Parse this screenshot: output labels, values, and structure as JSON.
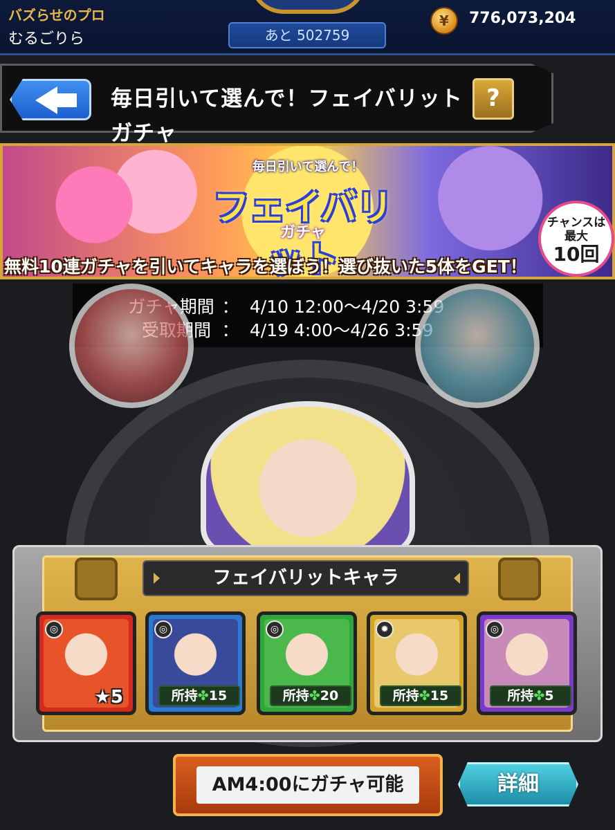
{
  "status": {
    "rank_title": "バズらせのプロ",
    "player_name": "むるごりら",
    "stamina_text": "あと 502759",
    "coin_amount": "776,073,204"
  },
  "header": {
    "title": "毎日引いて選んで！フェイバリットガチャ",
    "help_label": "?"
  },
  "banner": {
    "subtitle": "毎日引いて選んで！",
    "logo": "フェイバリット",
    "logo_sub": "ガチャ",
    "caption": "無料10連ガチャを引いてキャラを選ぼう！選び抜いた5体をGET！",
    "chance_line1": "チャンスは",
    "chance_line2": "最大",
    "chance_count": "10回"
  },
  "period": {
    "gacha_label": "ガチャ期間",
    "gacha_value": "4/10 12:00〜4/20 3:59",
    "receive_label": "受取期間",
    "receive_value": "4/19 4:00〜4/26 3:59",
    "separator": "："
  },
  "favorites": {
    "title": "フェイバリットキャラ",
    "cards": [
      {
        "frame_color": "#d42a1e",
        "art_color": "#e8542a",
        "rarity": "★5",
        "owned": ""
      },
      {
        "frame_color": "#2a7ad4",
        "art_color": "#3a4a9a",
        "rarity": "",
        "owned": "所持",
        "count": "15"
      },
      {
        "frame_color": "#2ea83a",
        "art_color": "#4ab84a",
        "rarity": "",
        "owned": "所持",
        "count": "20"
      },
      {
        "frame_color": "#d4a42a",
        "art_color": "#e8c86a",
        "rarity": "",
        "owned": "所持",
        "count": "15"
      },
      {
        "frame_color": "#7a3ac8",
        "art_color": "#c88ab8",
        "rarity": "",
        "owned": "所持",
        "count": "5"
      }
    ]
  },
  "footer": {
    "gacha_button": "AM4:00にガチャ可能",
    "detail_button": "詳細"
  }
}
